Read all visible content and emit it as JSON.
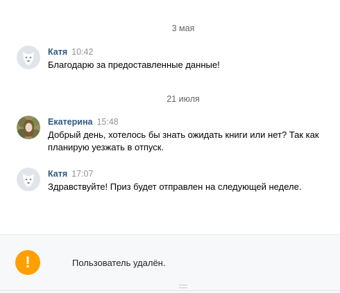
{
  "dates": [
    "3 мая",
    "21 июля"
  ],
  "messages": [
    {
      "author": "Катя",
      "time": "10:42",
      "text": "Благодарю за предоставленные данные!",
      "avatar": "deleted-user-dog"
    },
    {
      "author": "Екатерина",
      "time": "15:48",
      "text": "Добрый день, хотелось бы знать ожидать книги или нет? Так как планирую уезжать в отпуск.",
      "avatar": "user-photo"
    },
    {
      "author": "Катя",
      "time": "17:07",
      "text": "Здравствуйте! Приз будет отправлен на следующей неделе.",
      "avatar": "deleted-user-dog"
    }
  ],
  "footer": {
    "icon": "!",
    "text": "Пользователь удалён."
  },
  "colors": {
    "author": "#2a5885",
    "warning": "#ffa000",
    "footer_bg": "#f7f8fa"
  }
}
